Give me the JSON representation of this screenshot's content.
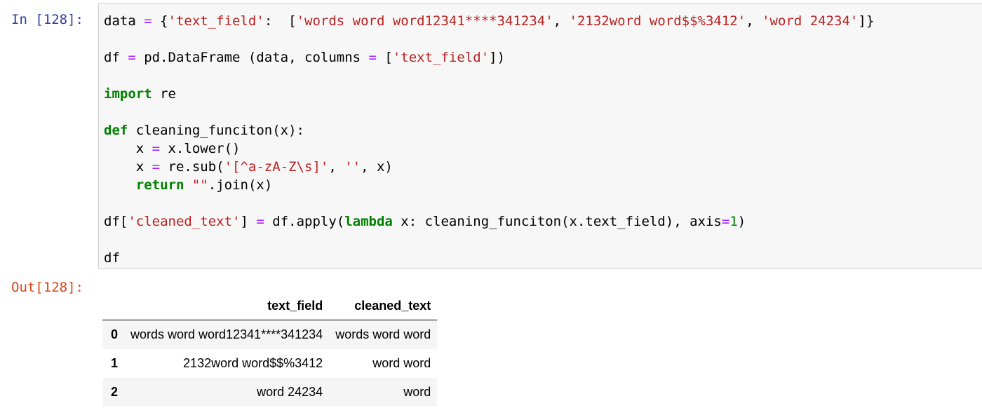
{
  "cell": {
    "in_prompt": "In [128]:",
    "out_prompt": "Out[128]:"
  },
  "code": {
    "line1": {
      "a": "data ",
      "b": "=",
      "c": " {",
      "d": "'text_field'",
      "e": ":  [",
      "f": "'words word word12341****341234'",
      "g": ", ",
      "h": "'2132word word$$%3412'",
      "i": ", ",
      "j": "'word 24234'",
      "k": "]}"
    },
    "line2": {
      "a": "df ",
      "b": "=",
      "c": " pd.DataFrame (data, columns ",
      "d": "=",
      "e": " [",
      "f": "'text_field'",
      "g": "])"
    },
    "line3": {
      "a": "import",
      "b": " re"
    },
    "line4": {
      "a": "def",
      "b": " cleaning_funciton(x):"
    },
    "line5": {
      "a": "    x ",
      "b": "=",
      "c": " x.lower()"
    },
    "line6": {
      "a": "    x ",
      "b": "=",
      "c": " re.sub(",
      "d": "'[^a-zA-Z\\s]'",
      "e": ", ",
      "f": "''",
      "g": ", x)"
    },
    "line7": {
      "a": "    ",
      "b": "return",
      "c": " ",
      "d": "\"\"",
      "e": ".join(x)"
    },
    "line8": {
      "a": "df[",
      "b": "'cleaned_text'",
      "c": "] ",
      "d": "=",
      "e": " df.apply(",
      "f": "lambda",
      "g": " x: cleaning_funciton(x.text_field), axis",
      "h": "=",
      "i": "1",
      "j": ")"
    },
    "line9": {
      "a": "df"
    }
  },
  "table": {
    "columns": [
      "",
      "text_field",
      "cleaned_text"
    ],
    "rows": [
      {
        "index": "0",
        "text_field": "words word word12341****341234",
        "cleaned_text": "words word word"
      },
      {
        "index": "1",
        "text_field": "2132word word$$%3412",
        "cleaned_text": "word word"
      },
      {
        "index": "2",
        "text_field": "word 24234",
        "cleaned_text": "word"
      }
    ]
  },
  "colors": {
    "in_prompt": "#303f9f",
    "out_prompt": "#d84315",
    "keyword": "#008000",
    "string": "#ba2121",
    "operator": "#aa22ff",
    "cell_background": "#f7f7f7"
  }
}
